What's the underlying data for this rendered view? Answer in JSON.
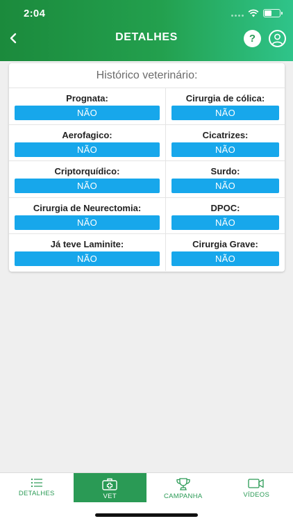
{
  "status_bar": {
    "time": "2:04"
  },
  "header": {
    "title": "DETALHES",
    "help_label": "?"
  },
  "card": {
    "title": "Histórico veterinário:",
    "fields": [
      {
        "label": "Prognata:",
        "value": "NÃO"
      },
      {
        "label": "Cirurgia de cólica:",
        "value": "NÃO"
      },
      {
        "label": "Aerofagico:",
        "value": "NÃO"
      },
      {
        "label": "Cicatrizes:",
        "value": "NÃO"
      },
      {
        "label": "Criptorquídico:",
        "value": "NÃO"
      },
      {
        "label": "Surdo:",
        "value": "NÃO"
      },
      {
        "label": "Cirurgia de Neurectomia:",
        "value": "NÃO"
      },
      {
        "label": "DPOC:",
        "value": "NÃO"
      },
      {
        "label": "Já teve Laminite:",
        "value": "NÃO"
      },
      {
        "label": "Cirurgia Grave:",
        "value": "NÃO"
      }
    ]
  },
  "tabs": [
    {
      "label": "DETALHES",
      "icon": "list-icon"
    },
    {
      "label": "VET",
      "icon": "medical-kit-icon",
      "active": true
    },
    {
      "label": "CAMPANHA",
      "icon": "trophy-icon"
    },
    {
      "label": "VÍDEOS",
      "icon": "video-camera-icon"
    }
  ],
  "colors": {
    "header_green": "#23a04e",
    "accent_blue": "#17a7eb",
    "tab_green": "#2a9a55"
  }
}
